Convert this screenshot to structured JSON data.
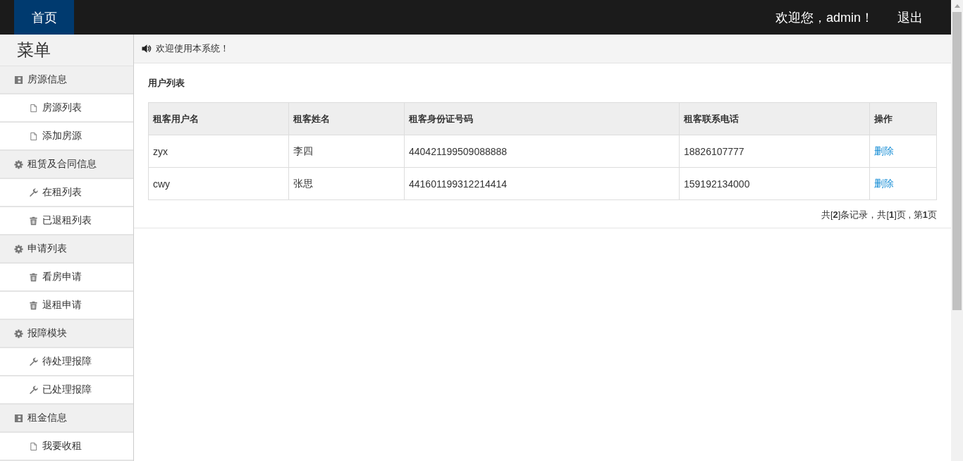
{
  "header": {
    "tabs": [
      {
        "label": "首页",
        "selected": true
      }
    ],
    "welcome": "欢迎您，admin！",
    "logout": "退出"
  },
  "sidebar": {
    "title": "菜单",
    "groups": [
      {
        "label": "房源信息",
        "kind": "book",
        "items": [
          {
            "label": "房源列表",
            "kind": "file"
          },
          {
            "label": "添加房源",
            "kind": "file"
          }
        ]
      },
      {
        "label": "租赁及合同信息",
        "kind": "gear",
        "items": [
          {
            "label": "在租列表",
            "kind": "wrench"
          },
          {
            "label": "已退租列表",
            "kind": "trash"
          }
        ]
      },
      {
        "label": "申请列表",
        "kind": "gear",
        "items": [
          {
            "label": "看房申请",
            "kind": "trash"
          },
          {
            "label": "退租申请",
            "kind": "trash"
          }
        ]
      },
      {
        "label": "报障模块",
        "kind": "gear",
        "items": [
          {
            "label": "待处理报障",
            "kind": "wrench"
          },
          {
            "label": "已处理报障",
            "kind": "wrench"
          }
        ]
      },
      {
        "label": "租金信息",
        "kind": "book",
        "items": [
          {
            "label": "我要收租",
            "kind": "file"
          }
        ]
      }
    ]
  },
  "notice": "欢迎使用本系统！",
  "panel": {
    "title": "用户列表",
    "table": {
      "columns": [
        "租客用户名",
        "租客姓名",
        "租客身份证号码",
        "租客联系电话",
        "操作"
      ],
      "rows": [
        {
          "cells": [
            "zyx",
            "李四",
            "440421199509088888",
            "18826107777"
          ],
          "action": "删除"
        },
        {
          "cells": [
            "cwy",
            "张思",
            "441601199312214414",
            "159192134000"
          ],
          "action": "删除"
        }
      ]
    },
    "pagination": "共[**2**]条记录，共[**1**]页 , 第**1**页"
  }
}
